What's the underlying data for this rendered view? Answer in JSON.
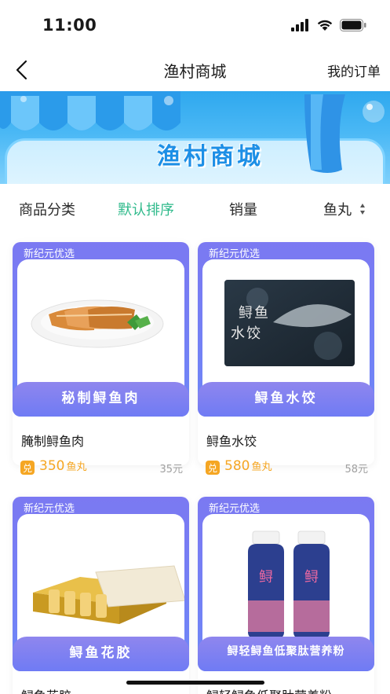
{
  "status_bar": {
    "time": "11:00"
  },
  "nav": {
    "title": "渔村商城",
    "orders_label": "我的订单"
  },
  "banner": {
    "title": "渔村商城"
  },
  "sort_bar": {
    "items": [
      {
        "label": "商品分类"
      },
      {
        "label": "默认排序"
      },
      {
        "label": "销量"
      },
      {
        "label": "鱼丸"
      }
    ],
    "active": "默认排序"
  },
  "products": [
    {
      "tag": "新纪元优选",
      "ribbon": "秘制鲟鱼肉",
      "name": "腌制鲟鱼肉",
      "price": "350",
      "unit": "鱼丸",
      "original": "35元"
    },
    {
      "tag": "新纪元优选",
      "ribbon": "鲟鱼水饺",
      "name": "鲟鱼水饺",
      "price": "580",
      "unit": "鱼丸",
      "original": "58元"
    },
    {
      "tag": "新纪元优选",
      "ribbon": "鲟鱼花胶",
      "name": "鲟鱼花胶"
    },
    {
      "tag": "新纪元优选",
      "ribbon": "鲟轻鲟鱼低聚肽营养粉",
      "name": "鲟轻鲟鱼低聚肽营养粉"
    }
  ],
  "colors": {
    "accent_green": "#2fba8b",
    "price_orange": "#f5a623",
    "card_purple": "#7b79f2",
    "banner_blue": "#2fa8ee"
  }
}
